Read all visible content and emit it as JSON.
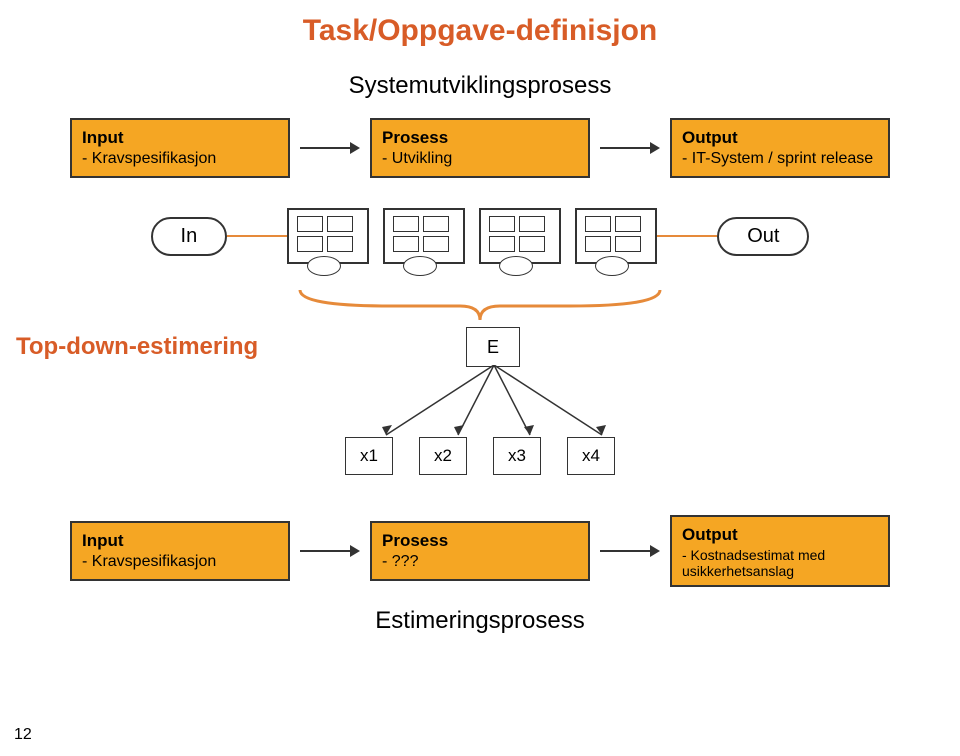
{
  "title": "Task/Oppgave-definisjon",
  "subtitle": "Systemutviklingsprosess",
  "row1": {
    "input": {
      "title": "Input",
      "sub": "- Kravspesifikasjon"
    },
    "prosess": {
      "title": "Prosess",
      "sub": "- Utvikling"
    },
    "output": {
      "title": "Output",
      "sub": "- IT-System / sprint release"
    }
  },
  "inout": {
    "in": "In",
    "out": "Out"
  },
  "topdown": {
    "label": "Top-down-estimering",
    "e": "E"
  },
  "xs": [
    "x1",
    "x2",
    "x3",
    "x4"
  ],
  "row2": {
    "input": {
      "title": "Input",
      "sub": "- Kravspesifikasjon"
    },
    "prosess": {
      "title": "Prosess",
      "sub": "- ???"
    },
    "output": {
      "title": "Output",
      "sub": "- Kostnadsestimat med usikkerhetsanslag"
    }
  },
  "footer": "Estimeringsprosess",
  "page": "12"
}
